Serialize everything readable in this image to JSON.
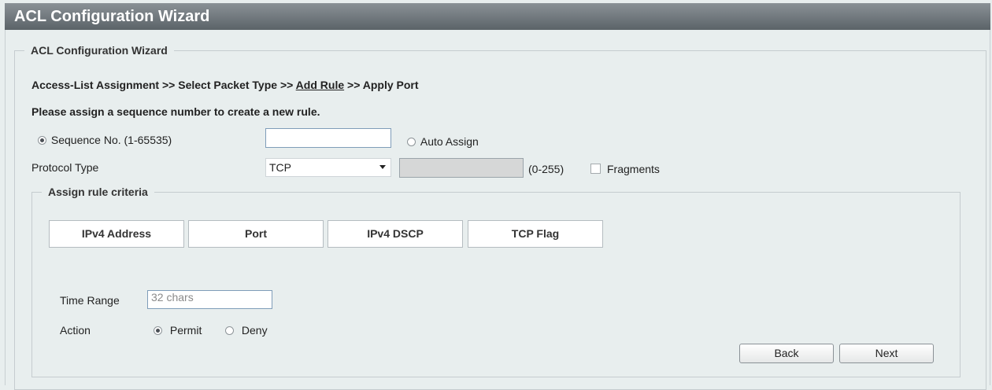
{
  "window": {
    "title": "ACL Configuration Wizard"
  },
  "wizard": {
    "legend": "ACL Configuration Wizard",
    "breadcrumb": {
      "step1": "Access-List Assignment",
      "sep": ">>",
      "step2": "Select Packet Type",
      "step3": "Add Rule",
      "step4": "Apply Port"
    },
    "prompt": "Please assign a sequence number to create a new rule."
  },
  "sequence": {
    "label": "Sequence No. (1-65535)",
    "selected": true,
    "value": "",
    "auto_assign_label": "Auto Assign",
    "auto_assign_selected": false
  },
  "protocol": {
    "label": "Protocol Type",
    "selected": "TCP",
    "id_value": "",
    "range_hint": "(0-255)",
    "fragments_label": "Fragments",
    "fragments_checked": false
  },
  "criteria": {
    "legend": "Assign rule criteria",
    "tabs": [
      {
        "label": "IPv4 Address"
      },
      {
        "label": "Port"
      },
      {
        "label": "IPv4 DSCP"
      },
      {
        "label": "TCP Flag"
      }
    ],
    "time_range": {
      "label": "Time Range",
      "placeholder": "32 chars"
    },
    "action": {
      "label": "Action",
      "permit_label": "Permit",
      "deny_label": "Deny",
      "selected": "Permit"
    }
  },
  "buttons": {
    "back": "Back",
    "next": "Next"
  }
}
